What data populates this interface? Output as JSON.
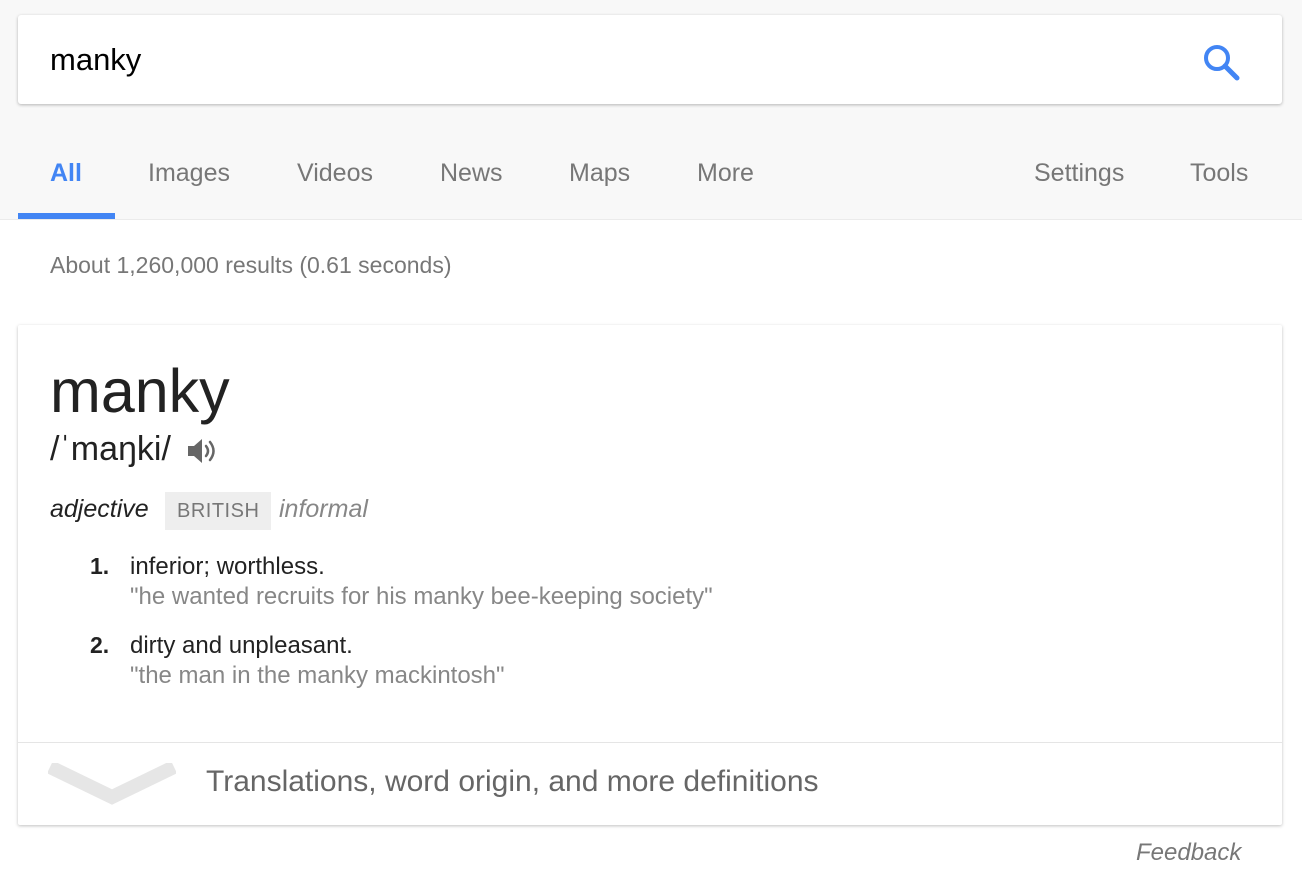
{
  "search": {
    "query": "manky"
  },
  "tabs": [
    {
      "label": "All",
      "active": true
    },
    {
      "label": "Images"
    },
    {
      "label": "Videos"
    },
    {
      "label": "News"
    },
    {
      "label": "Maps"
    },
    {
      "label": "More"
    },
    {
      "label": "Settings"
    },
    {
      "label": "Tools"
    }
  ],
  "result_stats": "About 1,260,000 results (0.61 seconds)",
  "dictionary": {
    "word": "manky",
    "phonetic": "/ˈmaŋki/",
    "part_of_speech": "adjective",
    "region": "BRITISH",
    "register": "informal",
    "definitions": [
      {
        "number": "1.",
        "text": "inferior; worthless.",
        "example": "\"he wanted recruits for his manky bee-keeping society\""
      },
      {
        "number": "2.",
        "text": "dirty and unpleasant.",
        "example": "\"the man in the manky mackintosh\""
      }
    ],
    "more_label": "Translations, word origin, and more definitions"
  },
  "feedback_label": "Feedback",
  "colors": {
    "accent": "#4285f4",
    "tab_text": "#777777",
    "example_text": "#878787",
    "badge_bg": "#eeeeee"
  },
  "icons": {
    "search": "search-icon",
    "speaker": "speaker-icon",
    "expand": "chevron-down-icon"
  }
}
